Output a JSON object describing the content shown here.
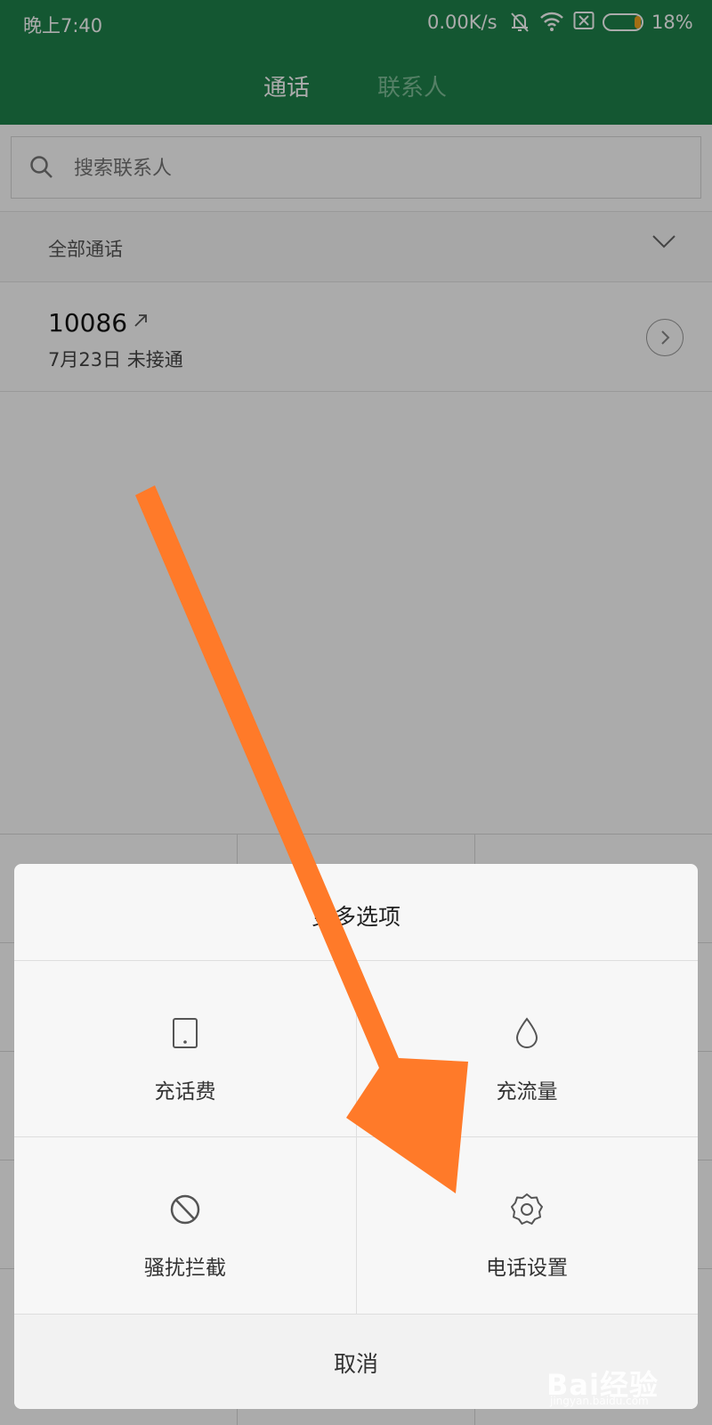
{
  "status_bar": {
    "time": "晚上7:40",
    "network_speed": "0.00K/s",
    "battery_percent": "18%",
    "battery_level": 0.18,
    "icons": [
      "notification-off-icon",
      "wifi-icon",
      "sim-disabled-icon",
      "battery-icon"
    ]
  },
  "tabs": [
    {
      "label": "通话",
      "active": true
    },
    {
      "label": "联系人",
      "active": false
    }
  ],
  "search": {
    "placeholder": "搜索联系人"
  },
  "filter": {
    "label": "全部通话"
  },
  "call_log": [
    {
      "number": "10086",
      "direction": "outgoing",
      "detail": "7月23日 未接通"
    }
  ],
  "sheet": {
    "title": "更多选项",
    "options": [
      {
        "label": "充话费",
        "icon": "phone-icon"
      },
      {
        "label": "充流量",
        "icon": "droplet-icon"
      },
      {
        "label": "骚扰拦截",
        "icon": "block-icon"
      },
      {
        "label": "电话设置",
        "icon": "gear-icon"
      }
    ],
    "cancel_label": "取消"
  },
  "watermark": {
    "brand": "Bai经验",
    "site": "jingyan.baidu.com"
  },
  "colors": {
    "brand_green": "#1e824b",
    "annotation_orange": "#ff7a29",
    "battery_orange": "#f2a51f"
  }
}
